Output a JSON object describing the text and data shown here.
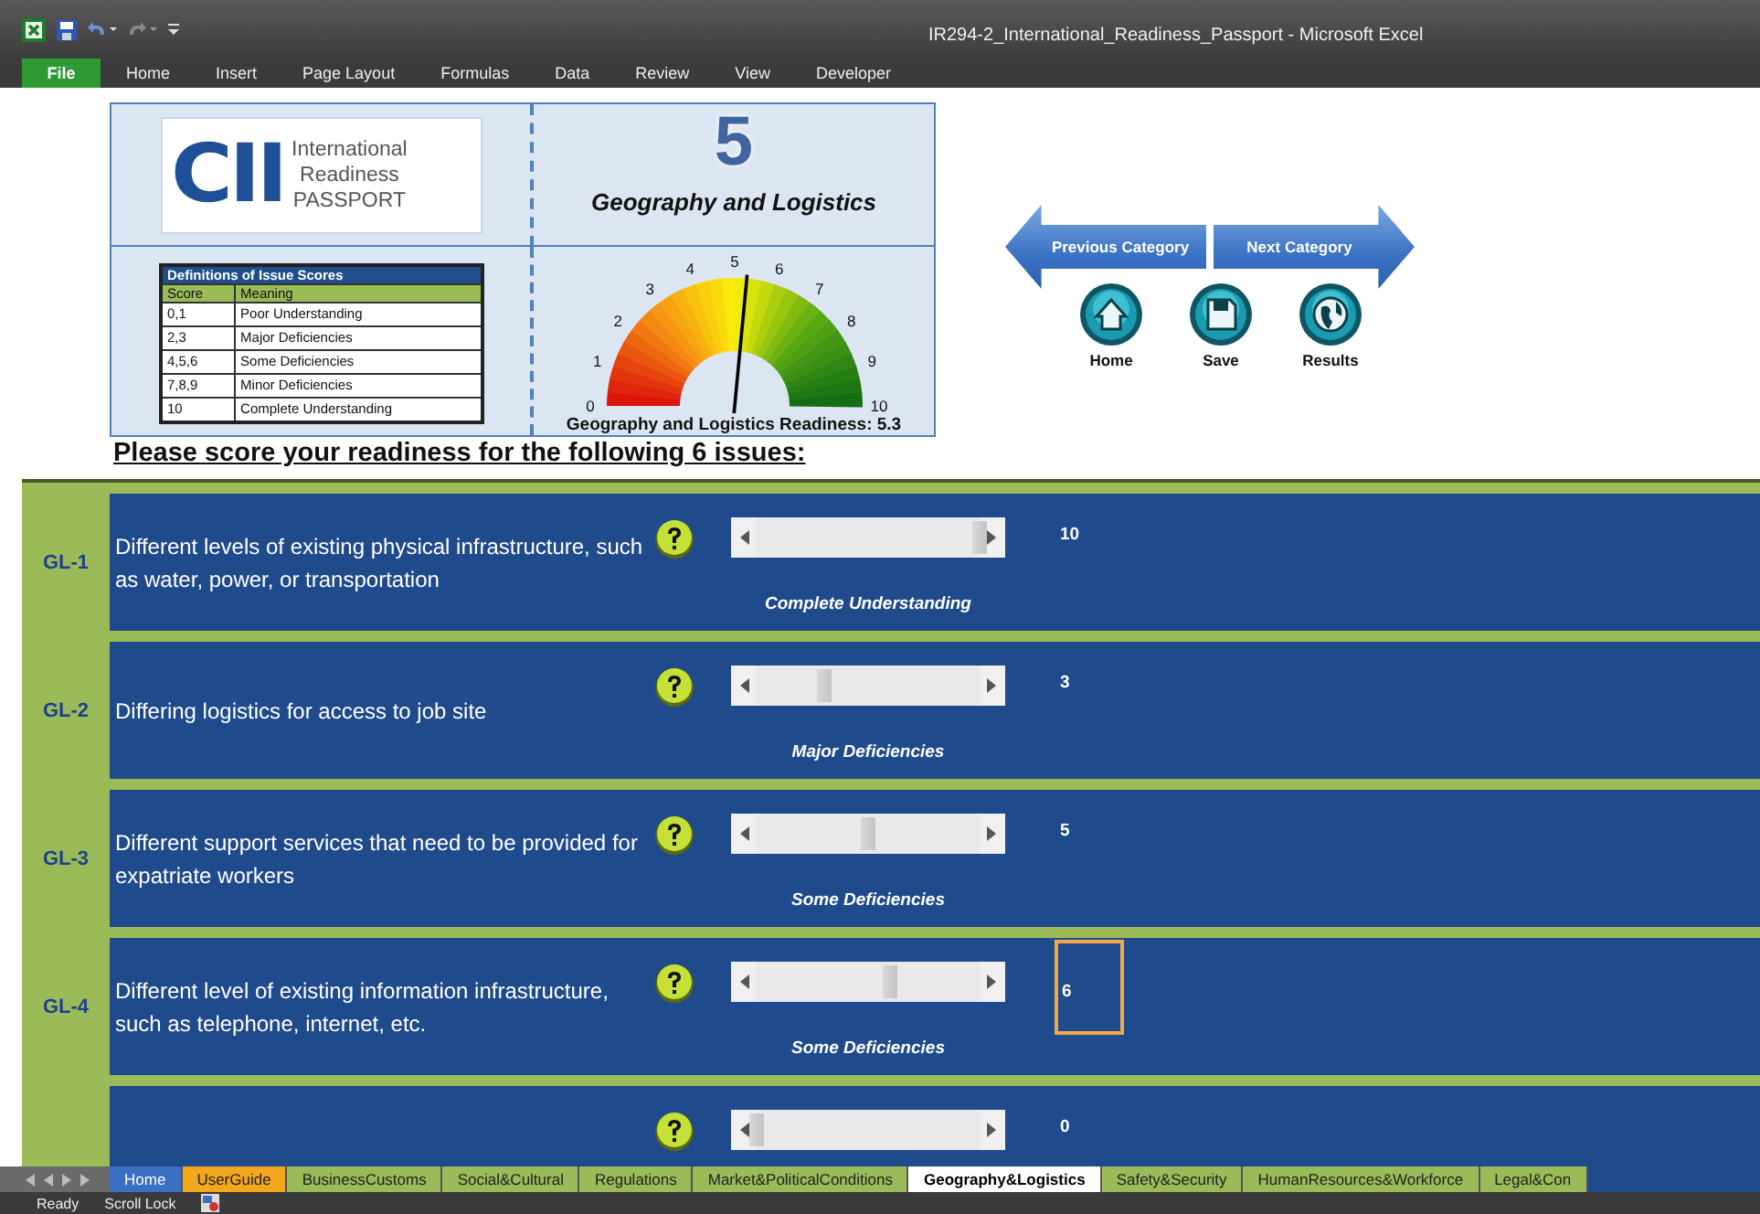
{
  "window": {
    "title": "IR294-2_International_Readiness_Passport  -  Microsoft Excel"
  },
  "file_tab": "File",
  "ribbon_tabs": [
    "Home",
    "Insert",
    "Page Layout",
    "Formulas",
    "Data",
    "Review",
    "View",
    "Developer"
  ],
  "header": {
    "logo_text": "CII",
    "logo_lines": [
      "International",
      "Readiness",
      "PASSPORT"
    ],
    "score": "5",
    "category": "Geography and Logistics"
  },
  "definitions": {
    "title": "Definitions of Issue Scores",
    "columns": [
      "Score",
      "Meaning"
    ],
    "rows": [
      [
        "0,1",
        "Poor Understanding"
      ],
      [
        "2,3",
        "Major Deficiencies"
      ],
      [
        "4,5,6",
        "Some Deficiencies"
      ],
      [
        "7,8,9",
        "Minor Deficiencies"
      ],
      [
        "10",
        "Complete Understanding"
      ]
    ]
  },
  "gauge": {
    "ticks": [
      "0",
      "1",
      "2",
      "3",
      "4",
      "5",
      "6",
      "7",
      "8",
      "9",
      "10"
    ],
    "caption": "Geography and Logistics Readiness: 5.3"
  },
  "nav": {
    "previous": "Previous Category",
    "next": "Next Category",
    "buttons": [
      {
        "label": "Home",
        "kind": "home"
      },
      {
        "label": "Save",
        "kind": "save"
      },
      {
        "label": "Results",
        "kind": "results"
      }
    ]
  },
  "prompt": "Please score your readiness for the following 6 issues:",
  "issues": [
    {
      "id": "GL-1",
      "text": "Different levels of existing physical infrastructure, such as water, power, or transportation",
      "level": 1,
      "value": "10",
      "scale_label": "Complete Understanding",
      "selected": false
    },
    {
      "id": "GL-2",
      "text": "Differing logistics for access to job site",
      "level": 0.3,
      "value": "3",
      "scale_label": "Major Deficiencies",
      "selected": false
    },
    {
      "id": "GL-3",
      "text": "Different support services that need to be provided for expatriate workers",
      "level": 0.5,
      "value": "5",
      "scale_label": "Some Deficiencies",
      "selected": false
    },
    {
      "id": "GL-4",
      "text": "Different level of existing information infrastructure, such as telephone, internet, etc.",
      "level": 0.6,
      "value": "6",
      "scale_label": "Some Deficiencies",
      "selected": true
    },
    {
      "level": 0,
      "value": "0",
      "selected": false
    }
  ],
  "sheet_tabs": [
    {
      "label": "Home",
      "color": "#3a6fc4",
      "selected": false
    },
    {
      "label": "UserGuide",
      "color": "#f2a81d",
      "selected": false
    },
    {
      "label": "BusinessCustoms",
      "color": "#9bbb59",
      "selected": false
    },
    {
      "label": "Social&Cultural",
      "color": "#9bbb59",
      "selected": false
    },
    {
      "label": "Regulations",
      "color": "#9bbb59",
      "selected": false
    },
    {
      "label": "Market&PoliticalConditions",
      "color": "#9bbb59",
      "selected": false
    },
    {
      "label": "Geography&Logistics",
      "selected": true
    },
    {
      "label": "Safety&Security",
      "color": "#9bbb59",
      "selected": false
    },
    {
      "label": "HumanResources&Workforce",
      "color": "#9bbb59",
      "selected": false
    },
    {
      "label": "Legal&Con",
      "color": "#9bbb59",
      "selected": false
    }
  ],
  "status_bar": [
    "Ready",
    "Scroll Lock"
  ]
}
